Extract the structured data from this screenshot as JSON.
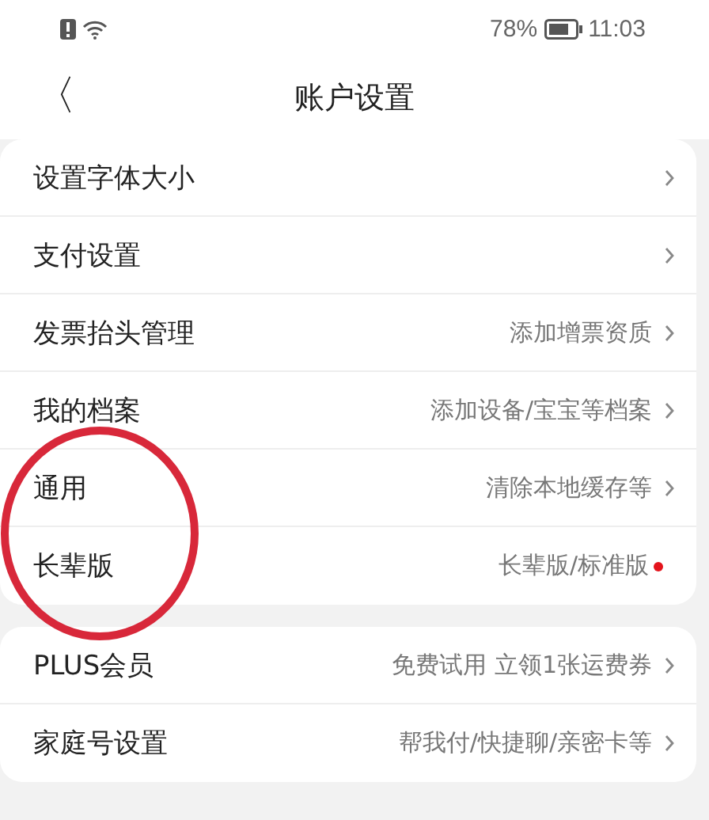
{
  "status_bar": {
    "battery_text": "78%",
    "time": "11:03"
  },
  "header": {
    "back": "〈",
    "title": "账户设置"
  },
  "groups": [
    {
      "items": [
        {
          "label": "设置字体大小",
          "dot": false
        },
        {
          "label": "支付设置",
          "dot": false
        },
        {
          "label": "发票抬头管理",
          "value": "添加增票资质",
          "dot": false
        },
        {
          "label": "我的档案",
          "value": "添加设备/宝宝等档案",
          "dot": false
        },
        {
          "label": "通用",
          "value": "清除本地缓存等",
          "dot": false
        },
        {
          "label": "长辈版",
          "value": "长辈版/标准版",
          "dot": true
        }
      ]
    },
    {
      "items": [
        {
          "label": "PLUS会员",
          "value": "免费试用 立领1张运费券",
          "dot": false
        },
        {
          "label": "家庭号设置",
          "value": "帮我付/快捷聊/亲密卡等",
          "dot": false
        }
      ]
    }
  ],
  "annotation": {
    "kind": "circle"
  }
}
